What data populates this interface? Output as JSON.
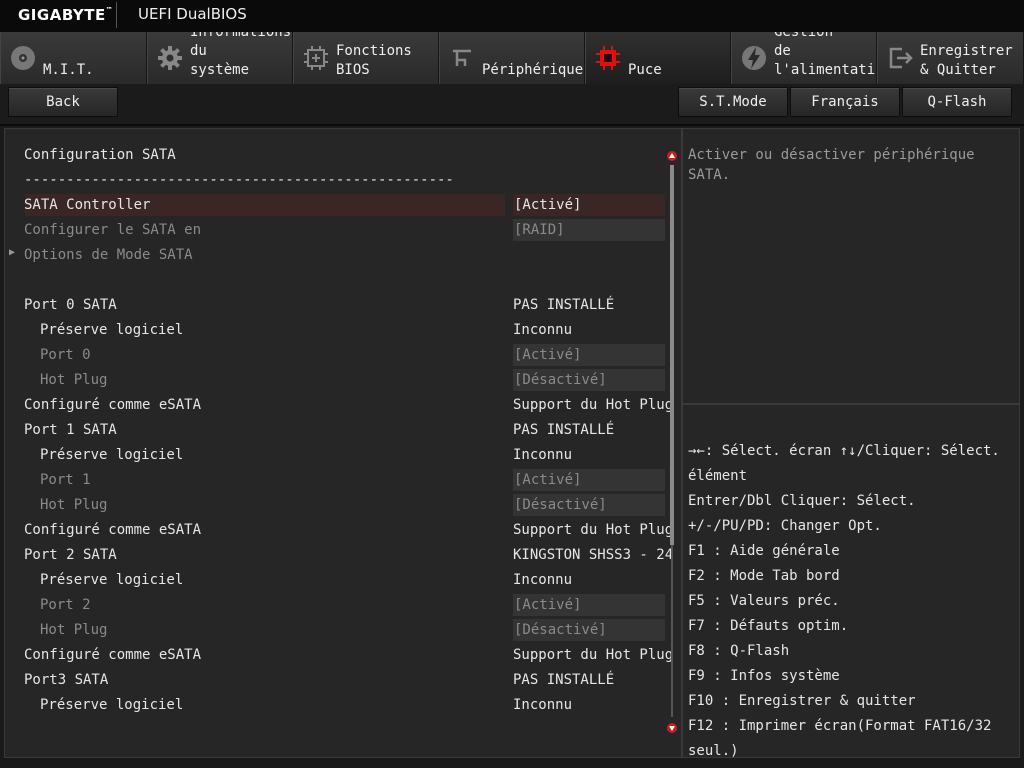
{
  "title": {
    "brand": "GIGABYTE",
    "product": "UEFI DualBIOS"
  },
  "tabs": [
    {
      "label": "M.I.T.",
      "icon": "disc-icon"
    },
    {
      "label": "Informations\ndu\nsystème",
      "icon": "gear-icon"
    },
    {
      "label": "Fonctions\nBIOS",
      "icon": "chip-plus-icon"
    },
    {
      "label": "Périphériques",
      "icon": "usb-icon"
    },
    {
      "label": "Puce",
      "icon": "red-chip-icon"
    },
    {
      "label": "Gestion\nde\nl'alimentation",
      "icon": "power-bolt-icon"
    },
    {
      "label": "Enregistrer\n& Quitter",
      "icon": "exit-icon"
    }
  ],
  "toolbar": {
    "back": "Back",
    "st_mode": "S.T.Mode",
    "language": "Français",
    "qflash": "Q-Flash"
  },
  "settings": {
    "heading": "Configuration SATA",
    "divider": "---------------------------------------------------",
    "rows": [
      {
        "label": "SATA Controller",
        "value": "[Activé]"
      },
      {
        "label": "Configurer le SATA en",
        "value": "[RAID]"
      },
      {
        "label": "Options de Mode SATA",
        "value": ""
      },
      {
        "label": "Port 0 SATA",
        "value": "PAS INSTALLÉ"
      },
      {
        "label": "Préserve logiciel",
        "value": "Inconnu"
      },
      {
        "label": "Port 0",
        "value": "[Activé]"
      },
      {
        "label": "Hot Plug",
        "value": "[Désactivé]"
      },
      {
        "label": "Configuré comme eSATA",
        "value": "Support du Hot Plug"
      },
      {
        "label": "Port 1 SATA",
        "value": "PAS INSTALLÉ"
      },
      {
        "label": "Préserve logiciel",
        "value": "Inconnu"
      },
      {
        "label": "Port 1",
        "value": "[Activé]"
      },
      {
        "label": "Hot Plug",
        "value": "[Désactivé]"
      },
      {
        "label": "Configuré comme eSATA",
        "value": "Support du Hot Plug"
      },
      {
        "label": "Port 2 SATA",
        "value": "KINGSTON SHSS3 - 24"
      },
      {
        "label": "Préserve logiciel",
        "value": "Inconnu"
      },
      {
        "label": "Port 2",
        "value": "[Activé]"
      },
      {
        "label": "Hot Plug",
        "value": "[Désactivé]"
      },
      {
        "label": "Configuré comme eSATA",
        "value": "Support du Hot Plug"
      },
      {
        "label": "Port3 SATA",
        "value": "PAS INSTALLÉ"
      },
      {
        "label": "Préserve logiciel",
        "value": "Inconnu"
      }
    ]
  },
  "help": {
    "text": "Activer ou désactiver périphérique SATA."
  },
  "keys": [
    "→←: Sélect. écran  ↑↓/Cliquer: Sélect.",
    "élément",
    "Entrer/Dbl Cliquer: Sélect.",
    "+/-/PU/PD: Changer Opt.",
    "F1  : Aide générale",
    "F2  : Mode Tab bord",
    "F5  : Valeurs préc.",
    "F7  : Défauts optim.",
    "F8  : Q-Flash",
    "F9  : Infos système",
    "F10 : Enregistrer & quitter",
    "F12 : Imprimer écran(Format FAT16/32",
    "seul.)"
  ]
}
